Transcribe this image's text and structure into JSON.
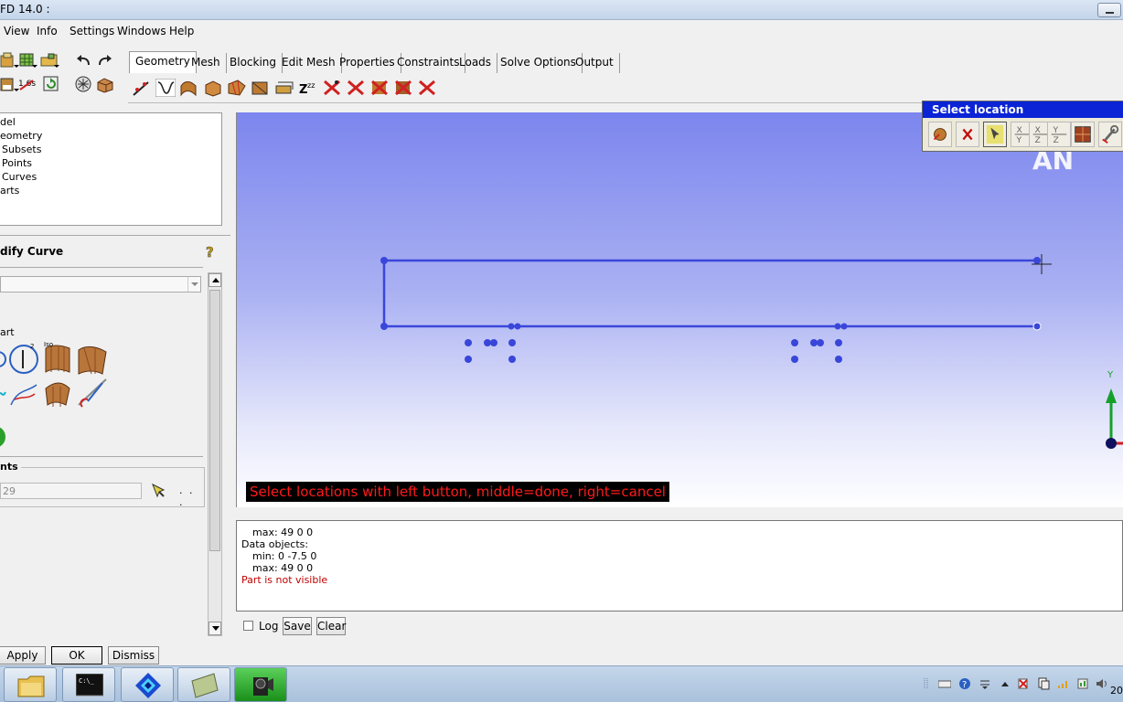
{
  "window": {
    "title": "FD 14.0 :"
  },
  "menu": [
    "View",
    "Info",
    "Settings",
    "Windows",
    "Help"
  ],
  "tabs": [
    "Geometry",
    "Mesh",
    "Blocking",
    "Edit Mesh",
    "Properties",
    "Constraints",
    "Loads",
    "Solve Options",
    "Output"
  ],
  "active_tab": "Geometry",
  "tree": [
    "del",
    "eometry",
    "Subsets",
    "Points",
    "Curves",
    "arts"
  ],
  "panel": {
    "title": "dify Curve",
    "part_label": "art",
    "points_legend": "nts",
    "points_value": "29",
    "points_more": ". . ."
  },
  "buttons": {
    "apply": "Apply",
    "ok": "OK",
    "dismiss": "Dismiss"
  },
  "viewport": {
    "status": "Select locations with left button, middle=done, right=cancel",
    "logo": "AN",
    "axis_label": "Y",
    "colors": {
      "curve": "#3a46d9",
      "status_text": "#ff1a1a",
      "axis_y": "#16a02a"
    }
  },
  "select_location": {
    "title": "Select location",
    "tool_labels": [
      "",
      "",
      "",
      "X Y",
      "X Z",
      "Y Z",
      "",
      ""
    ]
  },
  "console": {
    "lines": [
      "max: 49 0 0",
      "Data objects:",
      "min: 0 -7.5 0",
      "max: 49 0 0"
    ],
    "warning": "Part is not visible"
  },
  "log": {
    "label": "Log",
    "save": "Save",
    "clear": "Clear"
  },
  "taskbar": {
    "clock": "20"
  }
}
